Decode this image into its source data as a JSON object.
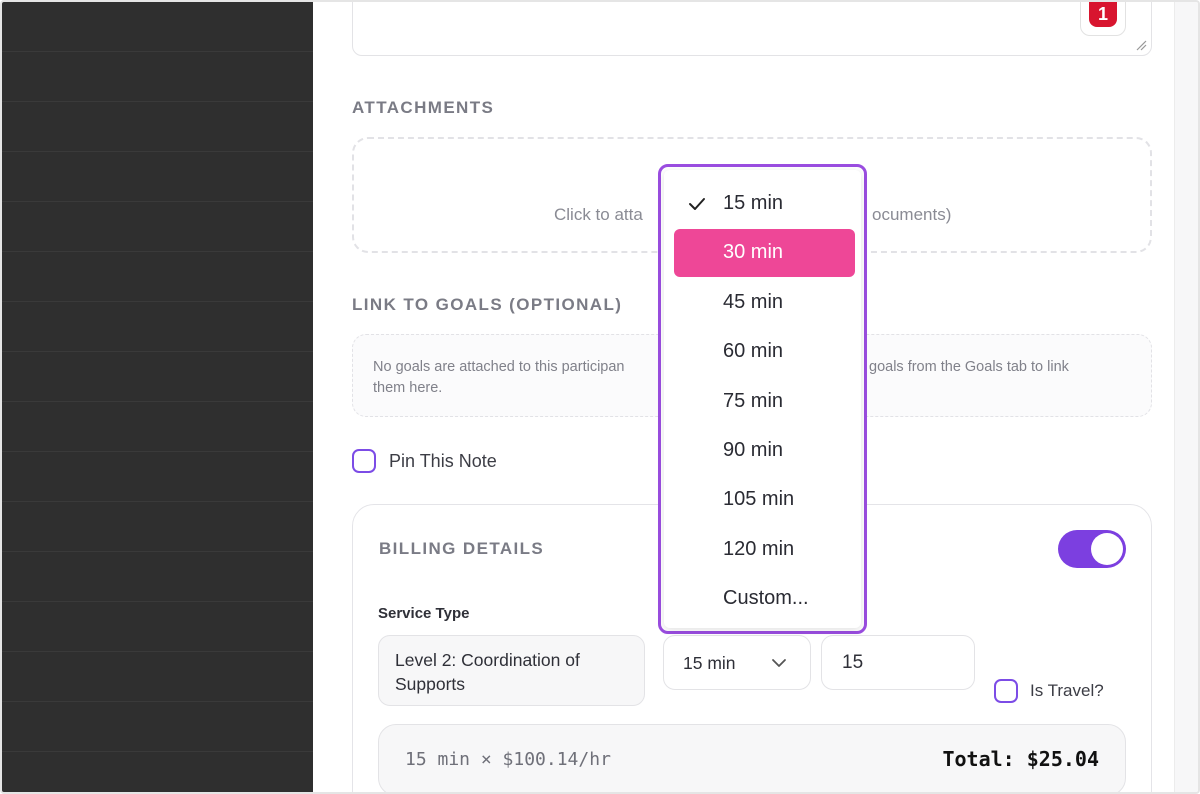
{
  "note": {
    "badge_count": "1"
  },
  "attachments": {
    "label": "ATTACHMENTS",
    "hint_left": "Click to atta",
    "hint_right": "ocuments)"
  },
  "goals": {
    "label": "LINK TO GOALS (OPTIONAL)",
    "empty_line1_left": "No goals are attached to this participan",
    "empty_line1_right": "goals from the Goals tab to link",
    "empty_line2": "them here."
  },
  "pin": {
    "label": "Pin This Note",
    "checked": false
  },
  "billing": {
    "title": "BILLING DETAILS",
    "enabled": true,
    "service_type_label": "Service Type",
    "service_type_value": "Level 2: Coordination of Supports",
    "duration_value": "15 min",
    "quantity_value": "15",
    "is_travel_label": "Is Travel?",
    "is_travel_checked": false,
    "calc_text": "15 min × $100.14/hr",
    "total_text": "Total: $25.04"
  },
  "duration_menu": {
    "selected": "15 min",
    "highlighted": "30 min",
    "options": [
      "15 min",
      "30 min",
      "45 min",
      "60 min",
      "75 min",
      "90 min",
      "105 min",
      "120 min",
      "Custom..."
    ]
  },
  "colors": {
    "accent_purple": "#7c3fe0",
    "highlight_pink": "#ee4797",
    "sidebar_bg": "#2f2f2f",
    "badge_red": "#d8152f"
  }
}
